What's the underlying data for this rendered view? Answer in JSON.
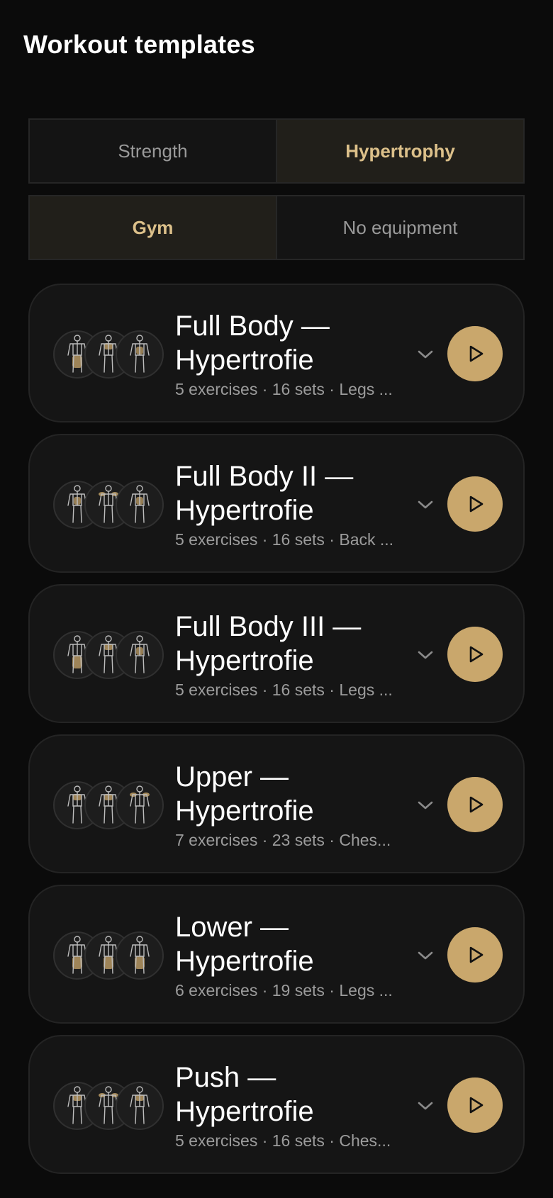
{
  "header": {
    "title": "Workout templates"
  },
  "filters": {
    "goal": [
      {
        "label": "Strength",
        "active": false
      },
      {
        "label": "Hypertrophy",
        "active": true
      }
    ],
    "equipment": [
      {
        "label": "Gym",
        "active": true
      },
      {
        "label": "No equipment",
        "active": false
      }
    ]
  },
  "colors": {
    "accent": "#c9a76c",
    "active_text": "#dcc08a",
    "background": "#0b0b0b",
    "card": "#151515",
    "muted_text": "#9c9c9c"
  },
  "workouts": [
    {
      "title_line1": "Full Body —",
      "title_line2": "Hypertrofie",
      "meta": "5 exercises · 16 sets · Legs ...",
      "icons": [
        "body-legs-icon",
        "body-chest-icon",
        "body-core-icon"
      ]
    },
    {
      "title_line1": "Full Body II —",
      "title_line2": "Hypertrofie",
      "meta": "5 exercises · 16 sets · Back ...",
      "icons": [
        "body-core-icon",
        "body-shoulders-icon",
        "body-core-icon"
      ]
    },
    {
      "title_line1": "Full Body III —",
      "title_line2": "Hypertrofie",
      "meta": "5 exercises · 16 sets · Legs ...",
      "icons": [
        "body-legs-icon",
        "body-chest-icon",
        "body-core-icon"
      ]
    },
    {
      "title_line1": "Upper —",
      "title_line2": "Hypertrofie",
      "meta": "7 exercises · 23 sets · Ches...",
      "icons": [
        "body-chest-icon",
        "body-chest-icon",
        "body-shoulders-icon"
      ]
    },
    {
      "title_line1": "Lower —",
      "title_line2": "Hypertrofie",
      "meta": "6 exercises · 19 sets · Legs ...",
      "icons": [
        "body-legs-icon",
        "body-legs-icon",
        "body-legs-icon"
      ]
    },
    {
      "title_line1": "Push —",
      "title_line2": "Hypertrofie",
      "meta": "5 exercises · 16 sets · Ches...",
      "icons": [
        "body-chest-icon",
        "body-shoulders-icon",
        "body-chest-icon"
      ]
    }
  ]
}
